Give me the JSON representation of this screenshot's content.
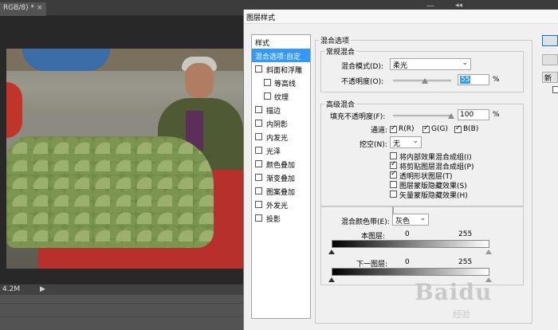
{
  "app": {
    "doc_tab": "RGB/8) *",
    "doc_tab_close": "×",
    "window_minimize": "—",
    "collapse_arrows": "◂◂",
    "status_zoom": "4.2M",
    "status_play": "▶"
  },
  "dialog": {
    "title": "图层样式",
    "styles_list": [
      {
        "label": "样式",
        "kind": "header"
      },
      {
        "label": "混合选项:自定",
        "kind": "selected"
      },
      {
        "label": "斜面和浮雕",
        "kind": "checkbox"
      },
      {
        "label": "等高线",
        "kind": "sub"
      },
      {
        "label": "纹理",
        "kind": "sub"
      },
      {
        "label": "描边",
        "kind": "checkbox"
      },
      {
        "label": "内阴影",
        "kind": "checkbox"
      },
      {
        "label": "内发光",
        "kind": "checkbox"
      },
      {
        "label": "光泽",
        "kind": "checkbox"
      },
      {
        "label": "颜色叠加",
        "kind": "checkbox"
      },
      {
        "label": "渐变叠加",
        "kind": "checkbox"
      },
      {
        "label": "图案叠加",
        "kind": "checkbox"
      },
      {
        "label": "外发光",
        "kind": "checkbox"
      },
      {
        "label": "投影",
        "kind": "checkbox"
      }
    ],
    "blend_options": {
      "title": "混合选项",
      "general": {
        "title": "常规混合",
        "blend_mode_label": "混合模式(D):",
        "blend_mode_value": "柔光",
        "opacity_label": "不透明度(O):",
        "opacity_value": "55",
        "opacity_unit": "%",
        "opacity_fraction": 0.55
      },
      "advanced": {
        "title": "高级混合",
        "fill_opacity_label": "填充不透明度(F):",
        "fill_opacity_value": "100",
        "fill_opacity_unit": "%",
        "fill_opacity_fraction": 1.0,
        "channels_label": "通道:",
        "channels": [
          {
            "label": "R(R)",
            "checked": true
          },
          {
            "label": "G(G)",
            "checked": true
          },
          {
            "label": "B(B)",
            "checked": true
          }
        ],
        "knockout_label": "挖空(N):",
        "knockout_value": "无",
        "options": [
          {
            "label": "将内部效果混合成组(I)",
            "checked": false
          },
          {
            "label": "将剪贴图层混合成组(P)",
            "checked": true
          },
          {
            "label": "透明形状图层(T)",
            "checked": true
          },
          {
            "label": "图层蒙版隐藏效果(S)",
            "checked": false
          },
          {
            "label": "矢量蒙版隐藏效果(H)",
            "checked": false
          }
        ]
      },
      "blend_if": {
        "label": "混合颜色带(E):",
        "value": "灰色",
        "this_layer_label": "本图层:",
        "this_layer_low": "0",
        "this_layer_high": "255",
        "underlying_label": "下一图层:",
        "underlying_low": "0",
        "underlying_high": "255"
      }
    },
    "right_buttons": [
      "",
      "",
      "新"
    ]
  },
  "watermark": {
    "main": "Baidu",
    "sub": "经验"
  }
}
